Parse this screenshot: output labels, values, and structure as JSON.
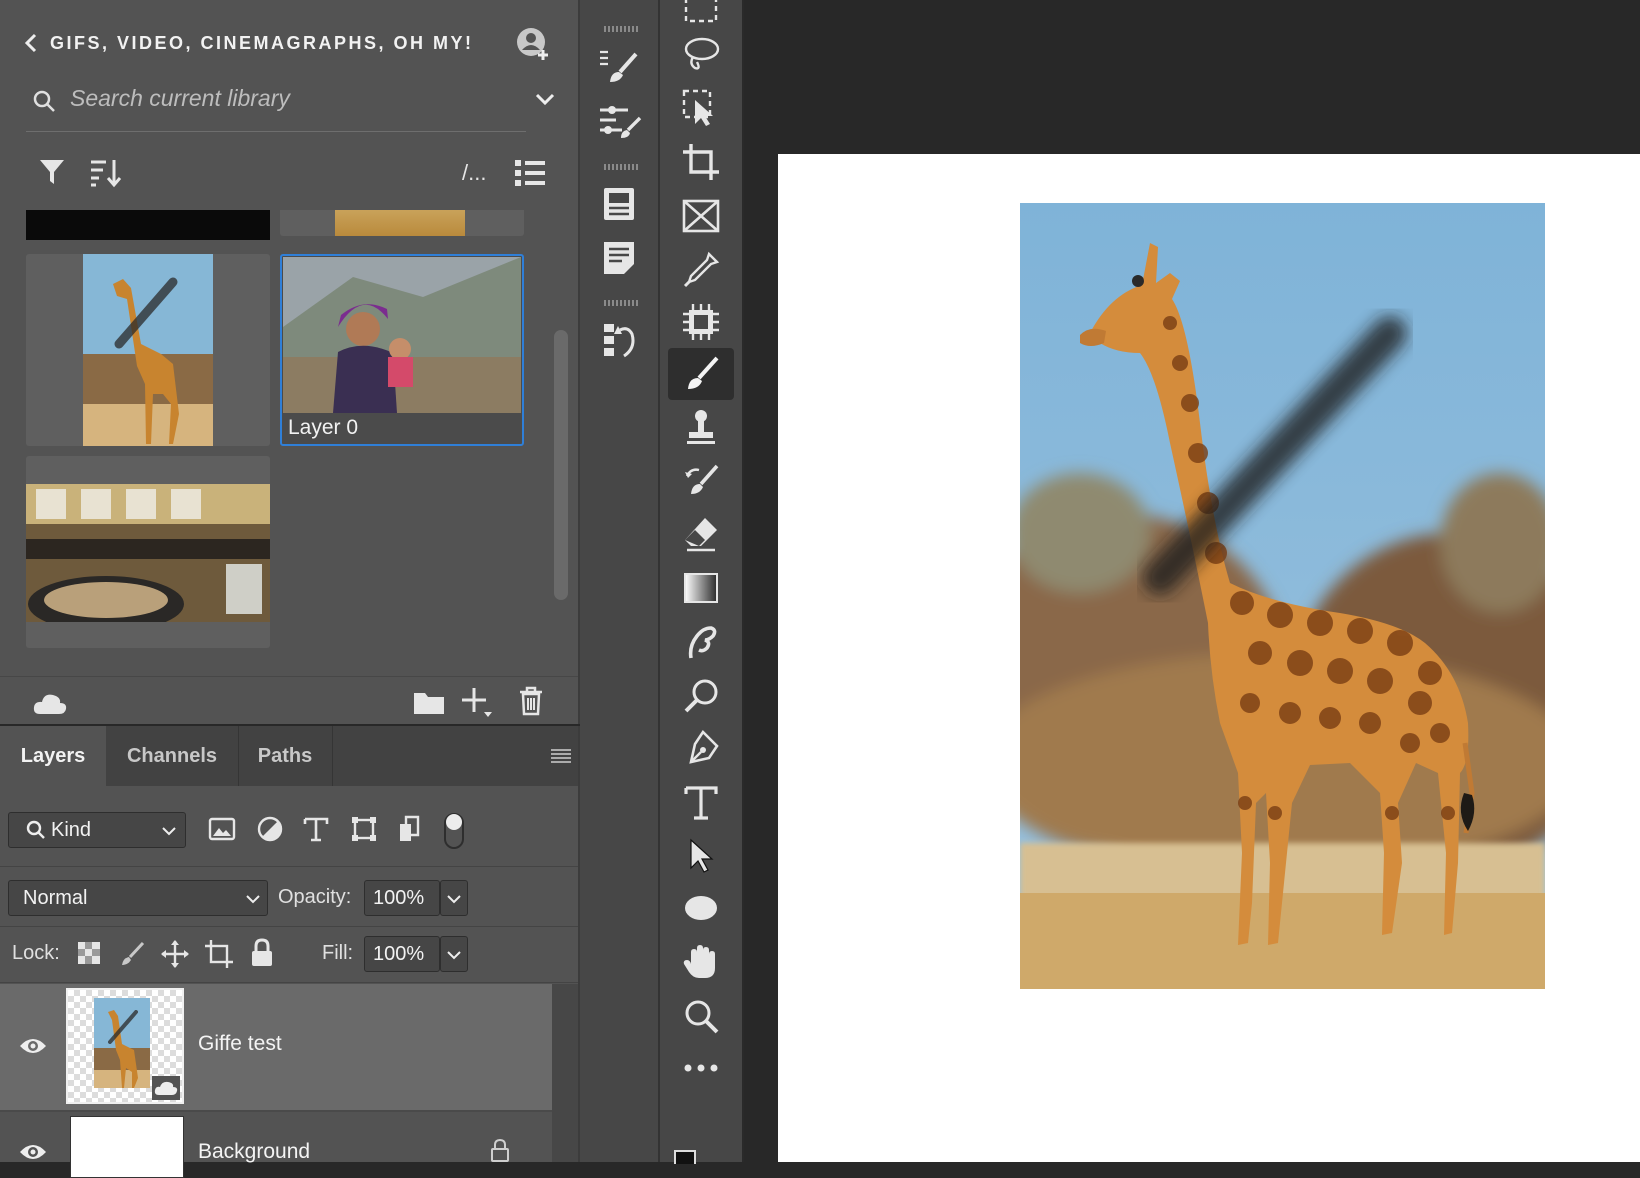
{
  "libraries": {
    "back_label": "GIFS, VIDEO, CINEMAGRAPHS, OH MY!",
    "search_placeholder": "Search current library",
    "view_label": "/...",
    "selected_item_label": "Layer 0"
  },
  "layers_panel": {
    "tabs": [
      "Layers",
      "Channels",
      "Paths"
    ],
    "kind_label": "Kind",
    "blend_mode": "Normal",
    "opacity_label": "Opacity:",
    "opacity_value": "100%",
    "lock_label": "Lock:",
    "fill_label": "Fill:",
    "fill_value": "100%",
    "layers": [
      {
        "name": "Giffe test"
      },
      {
        "name": "Background"
      }
    ]
  },
  "colors": {
    "panel_bg": "#535353",
    "toolbar_bg": "#474747",
    "workspace_bg": "#282828",
    "selection_blue": "#2f7fd8",
    "sky_blue": "#7fb3d8"
  }
}
